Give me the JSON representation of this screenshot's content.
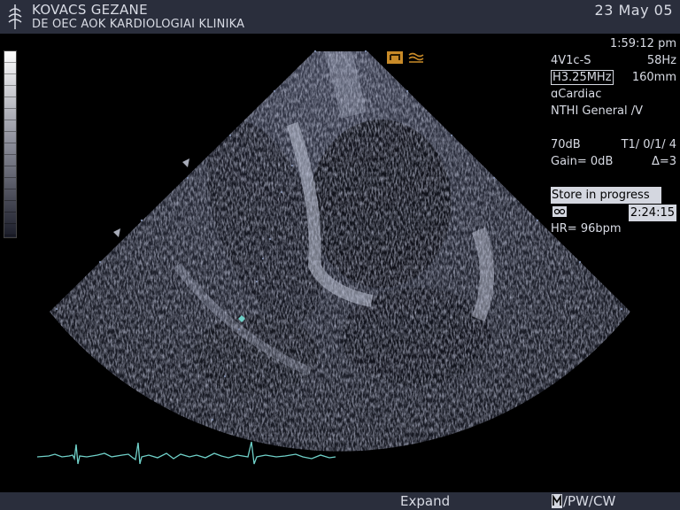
{
  "header": {
    "patient_name": "KOVACS GEZANE",
    "institution": "DE OEC AOK KARDIOLOGIAI KLINIKA",
    "date": "23 May 05"
  },
  "info_panel": {
    "time": "1:59:12 pm",
    "probe": "4V1c-S",
    "frame_rate": "58Hz",
    "frequency": "H3.25MHz",
    "depth": "160mm",
    "preset": "Cardiac",
    "preset_sub": "NTHI General /V",
    "dynamic_range": "70dB",
    "t_setting": "T1/  0/1/ 4",
    "gain": "Gain=   0dB",
    "delta": "Δ=3",
    "store_status": "Store in progress",
    "clip_time": "2:24:15",
    "heart_rate": "HR=  96bpm"
  },
  "footer": {
    "expand_label": "Expand",
    "mode_label": "/PW/CW"
  },
  "colors": {
    "bar_bg": "#2a2e3c",
    "text": "#d8dbe4",
    "ecg_trace": "#6fd0c8",
    "orientation_marker": "#c88a28"
  },
  "icons": [
    "logo-icon",
    "orientation-icon",
    "tape-icon",
    "mmode-icon",
    "grayscale-bar",
    "depth-marker-icon"
  ]
}
